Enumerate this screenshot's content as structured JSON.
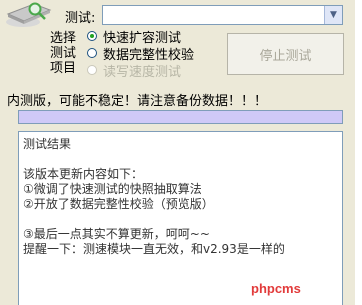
{
  "drive": {
    "label": "测试:",
    "value": ""
  },
  "mode": {
    "label_lines": [
      "选择",
      "测试",
      "项目"
    ],
    "options": [
      {
        "label": "快速扩容测试",
        "selected": true,
        "enabled": true
      },
      {
        "label": "数据完整性校验",
        "selected": false,
        "enabled": true
      },
      {
        "label": "读写速度测试",
        "selected": false,
        "enabled": false
      }
    ]
  },
  "stop_button": {
    "label": "停止测试",
    "enabled": false
  },
  "warning": "内测版，可能不稳定！请注意备份数据！！！",
  "progress": {
    "value": 0
  },
  "log_lines": [
    "测试结果",
    "",
    "该版本更新内容如下：",
    "①微调了快速测试的快照抽取算法",
    "②开放了数据完整性校验（预览版）",
    "",
    "③最后一点其实不算更新，呵呵~~",
    "提醒一下：测速模块一直无效，和v2.93是一样的"
  ],
  "watermark": "phpcms",
  "colors": {
    "window_bg": "#ece9d8",
    "progress_bg": "#cfc9f7",
    "radio_dot": "#21a121",
    "watermark": "#e23b3b"
  },
  "icons": {
    "logo": "usb-drive-magnifier-icon",
    "dropdown": "chevron-down-icon"
  }
}
